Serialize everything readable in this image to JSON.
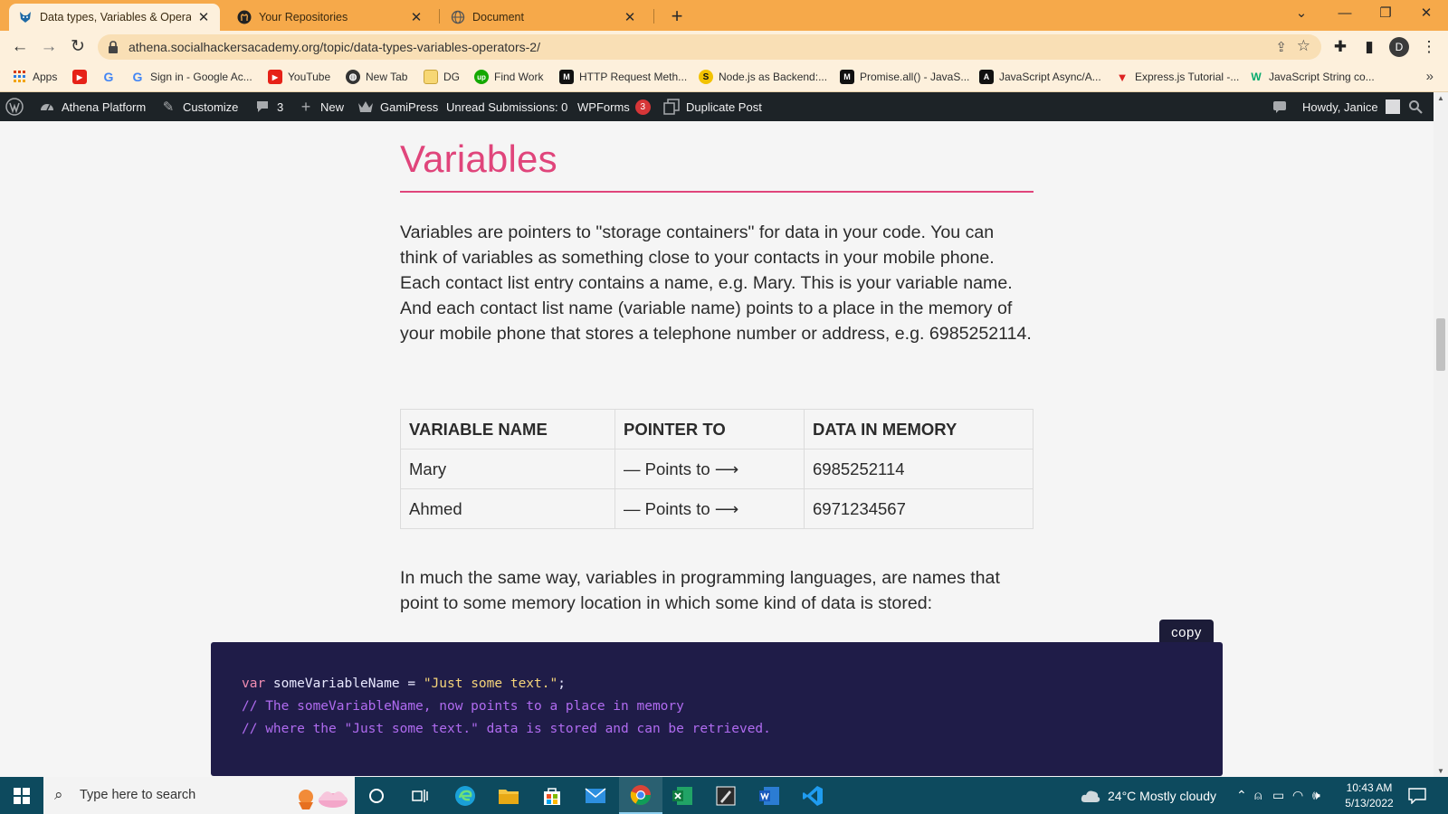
{
  "browser": {
    "tabs": [
      {
        "title": "Data types, Variables & Operators",
        "favicon": "athena-fox-icon",
        "active": true
      },
      {
        "title": "Your Repositories",
        "favicon": "github-icon",
        "active": false
      },
      {
        "title": "Document",
        "favicon": "globe-icon",
        "active": false
      }
    ],
    "url": "athena.socialhackersacademy.org/topic/data-types-variables-operators-2/",
    "profile_initial": "D",
    "bookmarks": [
      {
        "label": "Apps",
        "icon": "apps-grid-icon"
      },
      {
        "label": "",
        "icon": "youtube-icon"
      },
      {
        "label": "",
        "icon": "google-icon"
      },
      {
        "label": "Sign in - Google Ac...",
        "icon": "google-icon"
      },
      {
        "label": "YouTube",
        "icon": "youtube-icon"
      },
      {
        "label": "New Tab",
        "icon": "globe-icon"
      },
      {
        "label": "DG",
        "icon": "folder-icon"
      },
      {
        "label": "Find Work",
        "icon": "upwork-icon"
      },
      {
        "label": "HTTP Request Meth...",
        "icon": "mdn-icon"
      },
      {
        "label": "Node.js as Backend:...",
        "icon": "skillshare-icon"
      },
      {
        "label": "Promise.all() - JavaS...",
        "icon": "mdn-icon"
      },
      {
        "label": "JavaScript Async/A...",
        "icon": "mdn-icon"
      },
      {
        "label": "Express.js Tutorial -...",
        "icon": "tutorial-icon"
      },
      {
        "label": "JavaScript String co...",
        "icon": "w3schools-icon"
      }
    ]
  },
  "wp_admin_bar": {
    "site_name": "Athena Platform",
    "customize": "Customize",
    "comments_count": "3",
    "new_label": "New",
    "gamipress": "GamiPress",
    "unread": "Unread Submissions: 0",
    "wpforms": "WPForms",
    "wpforms_badge": "3",
    "duplicate": "Duplicate Post",
    "howdy": "Howdy, Janice"
  },
  "content": {
    "heading": "Variables",
    "paragraph1": "Variables are pointers to \"storage containers\" for data in your code. You can think of variables as something close to your contacts in your mobile phone. Each contact list entry contains a name, e.g. Mary. This is your variable name. And each contact list name (variable name) points to a place in the memory of your mobile phone that stores a telephone number or address, e.g. 6985252114.",
    "table": {
      "headers": [
        "VARIABLE NAME",
        "POINTER TO",
        "DATA IN MEMORY"
      ],
      "rows": [
        [
          "Mary",
          "— Points to ⟶",
          "6985252114"
        ],
        [
          "Ahmed",
          "— Points to ⟶",
          "6971234567"
        ]
      ]
    },
    "paragraph2": "In much the same way, variables in programming languages, are names that point to some memory location in which some kind of data is stored:",
    "copy_label": "copy",
    "code": {
      "keyword": "var",
      "identifier": " someVariableName = ",
      "string": "\"Just some text.\"",
      "terminator": ";",
      "comment1": "// The someVariableName, now points to a place in memory",
      "comment2": "// where the \"Just some text.\" data is stored and can be retrieved."
    }
  },
  "taskbar": {
    "search_placeholder": "Type here to search",
    "weather": "24°C  Mostly cloudy",
    "time": "10:43 AM",
    "date": "5/13/2022"
  },
  "colors": {
    "browser_accent": "#f6a94a",
    "heading_pink": "#e0457b",
    "code_bg": "#1f1c48",
    "wp_bar": "#1d2327",
    "taskbar": "#0d4a5e"
  }
}
